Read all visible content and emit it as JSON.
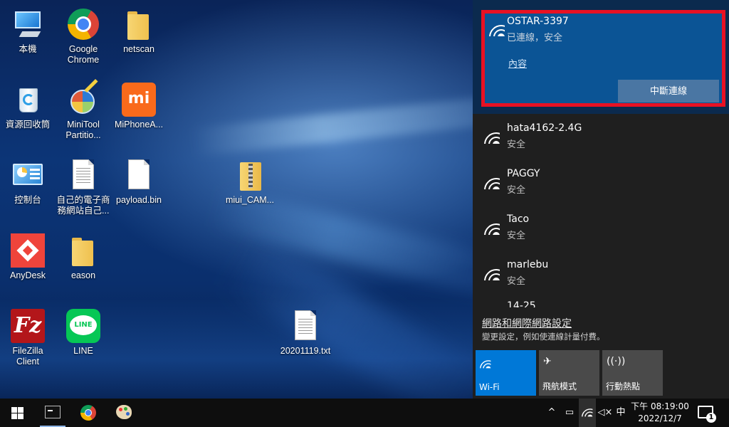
{
  "desktop": {
    "icons": [
      {
        "label": "本機",
        "icon": "this-pc-icon"
      },
      {
        "label": "Google Chrome",
        "icon": "chrome-icon"
      },
      {
        "label": "netscan",
        "icon": "folder-icon"
      },
      {
        "label": "資源回收筒",
        "icon": "recycle-bin-icon"
      },
      {
        "label": "MiniTool Partitio...",
        "icon": "minitool-icon"
      },
      {
        "label": "MiPhoneA...",
        "icon": "mi-icon"
      },
      {
        "label": "控制台",
        "icon": "control-panel-icon"
      },
      {
        "label": "自己的電子商務網站自己...",
        "icon": "document-icon"
      },
      {
        "label": "payload.bin",
        "icon": "file-icon"
      },
      {
        "label": "miui_CAM...",
        "icon": "zip-folder-icon"
      },
      {
        "label": "AnyDesk",
        "icon": "anydesk-icon"
      },
      {
        "label": "eason",
        "icon": "folder-icon"
      },
      {
        "label": "FileZilla Client",
        "icon": "filezilla-icon"
      },
      {
        "label": "LINE",
        "icon": "line-icon"
      },
      {
        "label": "20201119.txt",
        "icon": "text-file-icon"
      }
    ]
  },
  "wifi_flyout": {
    "connected": {
      "ssid": "OSTAR-3397",
      "status": "已連線，安全",
      "properties_link": "內容",
      "disconnect_label": "中斷連線"
    },
    "networks": [
      {
        "ssid": "hata4162-2.4G",
        "status": "安全"
      },
      {
        "ssid": "PAGGY",
        "status": "安全"
      },
      {
        "ssid": "Taco",
        "status": "安全"
      },
      {
        "ssid": "marlebu",
        "status": "安全"
      },
      {
        "ssid": "14-25",
        "status": ""
      }
    ],
    "settings_link": "網路和網際網路設定",
    "settings_sub": "變更設定，例如使連線計量付費。",
    "quick_actions": [
      {
        "label": "Wi-Fi",
        "icon": "wifi-icon",
        "active": true
      },
      {
        "label": "飛航模式",
        "icon": "airplane-icon",
        "active": false
      },
      {
        "label": "行動熱點",
        "icon": "hotspot-icon",
        "active": false
      }
    ],
    "highlight_color": "#e81123",
    "accent_color": "#0078d7"
  },
  "taskbar": {
    "apps": [
      "cmd-icon",
      "chrome-icon",
      "paint-icon"
    ],
    "tray": {
      "chevron": "^",
      "ime": "中",
      "time": "下午 08:19:00",
      "date": "2022/12/7",
      "notification_count": "1"
    }
  }
}
